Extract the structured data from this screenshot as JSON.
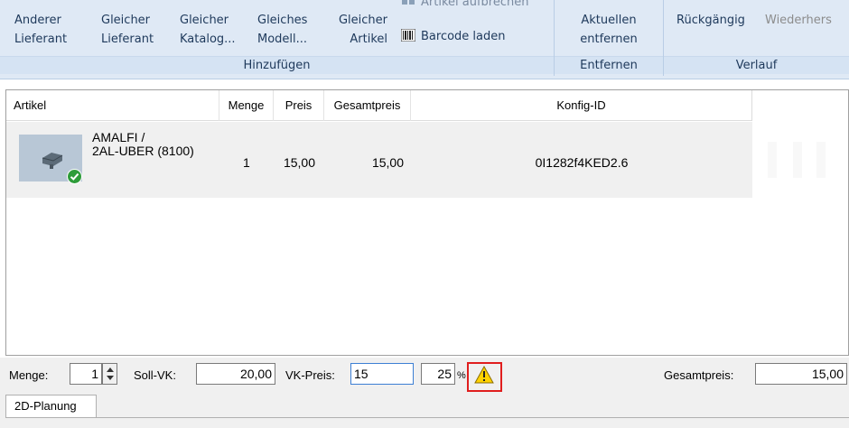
{
  "ribbon": {
    "add_group": {
      "label": "Hinzufügen",
      "buttons": [
        {
          "label": "Anderer\nLieferant"
        },
        {
          "label": "Gleicher\nLieferant"
        },
        {
          "label": "Gleicher\nKatalog..."
        },
        {
          "label": "Gleiches\nModell..."
        },
        {
          "label": "Gleicher\nArtikel"
        }
      ],
      "small_buttons": [
        {
          "label": "Artikel aufbrechen",
          "icon": "split-article-icon"
        },
        {
          "label": "Barcode laden",
          "icon": "barcode-icon"
        }
      ]
    },
    "remove_group": {
      "label": "Entfernen",
      "buttons": [
        {
          "label": "Aktuellen\nentfernen"
        }
      ]
    },
    "history_group": {
      "label": "Verlauf",
      "buttons": [
        {
          "label": "Rückgängig"
        },
        {
          "label": "Wiederhers"
        }
      ]
    }
  },
  "grid": {
    "columns": [
      "Artikel",
      "Menge",
      "Preis",
      "Gesamtpreis",
      "Konfig-ID"
    ],
    "rows": [
      {
        "artikel": "AMALFI /\n2AL-UBER (8100)",
        "menge": "1",
        "preis": "15,00",
        "gesamtpreis": "15,00",
        "konfig_id": "0I1282f4KED2.6",
        "status_icon": "check-icon"
      }
    ]
  },
  "bottom": {
    "menge_label": "Menge:",
    "menge_value": "1",
    "soll_vk_label": "Soll-VK:",
    "soll_vk_value": "20,00",
    "vk_preis_label": "VK-Preis:",
    "vk_preis_value": "15",
    "percent_value": "25",
    "percent_sign": "%",
    "warning_icon": "warning-icon",
    "gesamtpreis_label": "Gesamtpreis:",
    "gesamtpreis_value": "15,00"
  },
  "tabs": [
    {
      "label": "2D-Planung"
    }
  ],
  "colors": {
    "ribbon_bg": "#dfe9f5",
    "ribbon_text": "#1e395b",
    "highlight_border": "#e01e1e",
    "row_bg": "#f0f0f0"
  }
}
